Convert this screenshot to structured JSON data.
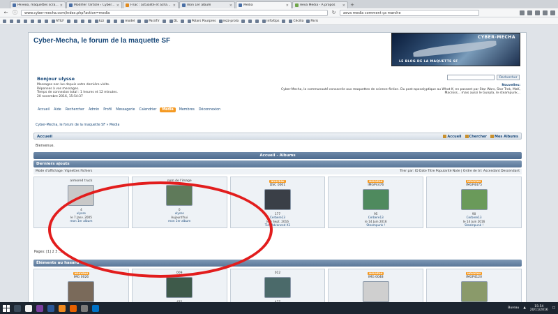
{
  "browser": {
    "tabs": [
      {
        "label": "Peveoo, maquettes scratc...",
        "active": false,
        "favicon": "#4a6fa5"
      },
      {
        "label": "Modifier l'article ‹ Cyber-...",
        "active": false,
        "favicon": "#4a6fa5"
      },
      {
        "label": "Fnac : actualité et achat e...",
        "active": false,
        "favicon": "#e08a1e"
      },
      {
        "label": "mon 1er album",
        "active": false,
        "favicon": "#4a6fa5"
      },
      {
        "label": "Media",
        "active": true,
        "favicon": "#4a6fa5"
      },
      {
        "label": "Aeva Media - À propos",
        "active": false,
        "favicon": "#6fa54a"
      }
    ],
    "url": "www.cyber-mecha.com/index.php?action=media",
    "search_value": "aeva media comment ça marche",
    "bookmarks": [
      "",
      "",
      "",
      "",
      "",
      "",
      "",
      "ATILF",
      "",
      "",
      "",
      "",
      "kzz",
      "",
      "",
      "model",
      "",
      "ParaTir",
      "",
      "DL",
      "",
      "Polars Pourpres",
      "rezz-proto",
      "",
      "",
      "",
      "info/tips",
      "",
      "Cécilia",
      "Paris"
    ]
  },
  "forum": {
    "title": "Cyber-Mecha, le forum de la maquette SF",
    "banner_top": "CYBER-MECHA",
    "banner_bottom": "LE BLOG DE LA MAQUETTE SF",
    "welcome_title": "Bonjour ulysse",
    "welcome_lines": [
      "Messages non lus depuis votre dernière visite.",
      "Réponses à vos messages.",
      "Temps de connexion total : 1 heures et 12 minutes.",
      "20 novembre 2016, 15:54:37"
    ],
    "search_button": "Rechercher",
    "news_title": "Nouvelles:",
    "news_text": "Cyber-Mecha, la communauté consacrée aux maquettes de science-fiction. Du post-apocalyptique au What If, en passant par Star Wars, Star Trek, MaK, Macross... mais aussi le Gunpla, le steampunk...",
    "menu": [
      "Accueil",
      "Aide",
      "Rechercher",
      "Admin",
      "Profil",
      "Messagerie",
      "Calendrier",
      "Media",
      "Membres",
      "Déconnexion"
    ],
    "menu_active": "Media",
    "breadcrumb": "Cyber-Mecha, le forum de la maquette SF » Media",
    "section_title": "Accueil",
    "section_actions": [
      "Accueil",
      "Chercher",
      "Mes Albums"
    ],
    "description": "Bienvenue.",
    "albums_bar": "Accueil - Albums",
    "latest_bar": "Derniers ajouts",
    "options_left": "Mode d'affichage: Vignettes Fichiers",
    "options_right": "Trier par: ID Date Titre Popularité Note | Ordre de tri: Ascendant Descendant",
    "latest_items": [
      {
        "new": "",
        "title": "armored truck",
        "views": "4",
        "user": "ulysse",
        "date": "le 7 Janv. 2005",
        "album": "mon 1er album",
        "thumb": "#c8c8c8"
      },
      {
        "new": "",
        "title": "nom de l'image",
        "views": "0",
        "user": "ulysse",
        "date": "Aujourd'hui",
        "album": "mon 1er album",
        "thumb": "#5f7a5a"
      },
      {
        "new": "NOUVEAU",
        "title": "DSC 0001",
        "views": "177",
        "user": "Cerbere13",
        "date": "le 5 Sept. 2016",
        "album": "Tie- Advanced X1",
        "thumb": "#3a3f47"
      },
      {
        "new": "NOUVEAU",
        "title": "IMGP4476",
        "views": "95",
        "user": "Cerbere13",
        "date": "le 14 Juin 2016",
        "album": "Steampunk !",
        "thumb": "#4f8a5e"
      },
      {
        "new": "NOUVEAU",
        "title": "IMGP4475",
        "views": "90",
        "user": "Cerbere13",
        "date": "le 14 Juin 2016",
        "album": "Steampunk !",
        "thumb": "#6a9a5a"
      }
    ],
    "pages": "Pages: [1] 2 3 ...",
    "random_bar": "Éléments au hasard",
    "random_items": [
      {
        "new": "NOUVEAU",
        "title": "IMG 0026",
        "views": "",
        "thumb": "#7a6a5a"
      },
      {
        "new": "",
        "title": "009",
        "views": "435",
        "thumb": "#3e5a4a"
      },
      {
        "new": "",
        "title": "012",
        "views": "477",
        "thumb": "#4b6a6a"
      },
      {
        "new": "NOUVEAU",
        "title": "IMG 0048",
        "views": "",
        "thumb": "#cfcfcf"
      },
      {
        "new": "NOUVEAU",
        "title": "IMGP4120",
        "views": "",
        "thumb": "#8a9a6a"
      }
    ]
  },
  "taskbar": {
    "time": "15:54",
    "date": "20/11/2016",
    "desktop_label": "Bureau"
  }
}
